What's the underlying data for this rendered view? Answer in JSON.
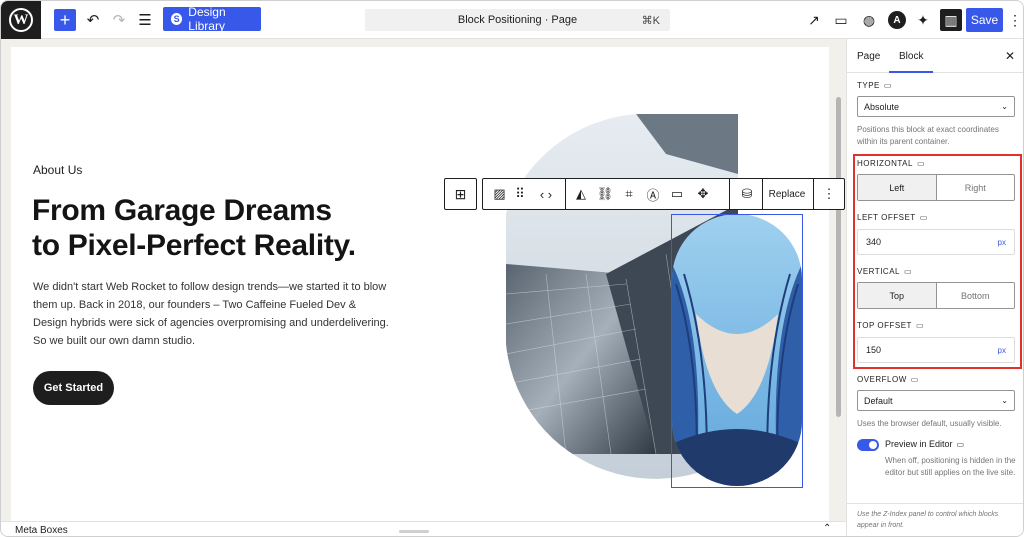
{
  "topbar": {
    "design_library_label": "Design Library",
    "design_library_icon": "S",
    "doc_title": "Block Positioning · Page",
    "shortcut": "⌘K",
    "save_label": "Save",
    "astra_letter": "A"
  },
  "canvas": {
    "eyebrow": "About Us",
    "headline_line1": "From Garage Dreams",
    "headline_line2": "to Pixel-Perfect Reality.",
    "body": "We didn't start Web Rocket to follow design trends—we started it to blow them up. Back in 2018, our founders – Two Caffeine Fueled Dev & Design hybrids were sick of agencies overpromising and underdelivering. So we built our own damn studio.",
    "cta_label": "Get Started"
  },
  "block_toolbar": {
    "replace_label": "Replace"
  },
  "meta_boxes": {
    "label": "Meta Boxes"
  },
  "sidebar": {
    "tabs": [
      "Page",
      "Block"
    ],
    "active_tab": "Block",
    "type_label": "TYPE",
    "type_value": "Absolute",
    "type_help": "Positions this block at exact coordinates within its parent container.",
    "horizontal_label": "HORIZONTAL",
    "horizontal_options": [
      "Left",
      "Right"
    ],
    "horizontal_selected": "Left",
    "left_offset_label": "LEFT OFFSET",
    "left_offset_value": "340",
    "left_offset_unit": "px",
    "vertical_label": "VERTICAL",
    "vertical_options": [
      "Top",
      "Bottom"
    ],
    "vertical_selected": "Top",
    "top_offset_label": "TOP OFFSET",
    "top_offset_value": "150",
    "top_offset_unit": "px",
    "overflow_label": "OVERFLOW",
    "overflow_value": "Default",
    "overflow_help": "Uses the browser default, usually visible.",
    "preview_label": "Preview in Editor",
    "preview_enabled": true,
    "preview_help": "When off, positioning is hidden in the editor but still applies on the live site.",
    "footer_note": "Use the Z-Index panel to control which blocks appear in front."
  },
  "colors": {
    "accent": "#3858e9",
    "highlight": "#e0312c",
    "dark": "#1e1e1e"
  }
}
